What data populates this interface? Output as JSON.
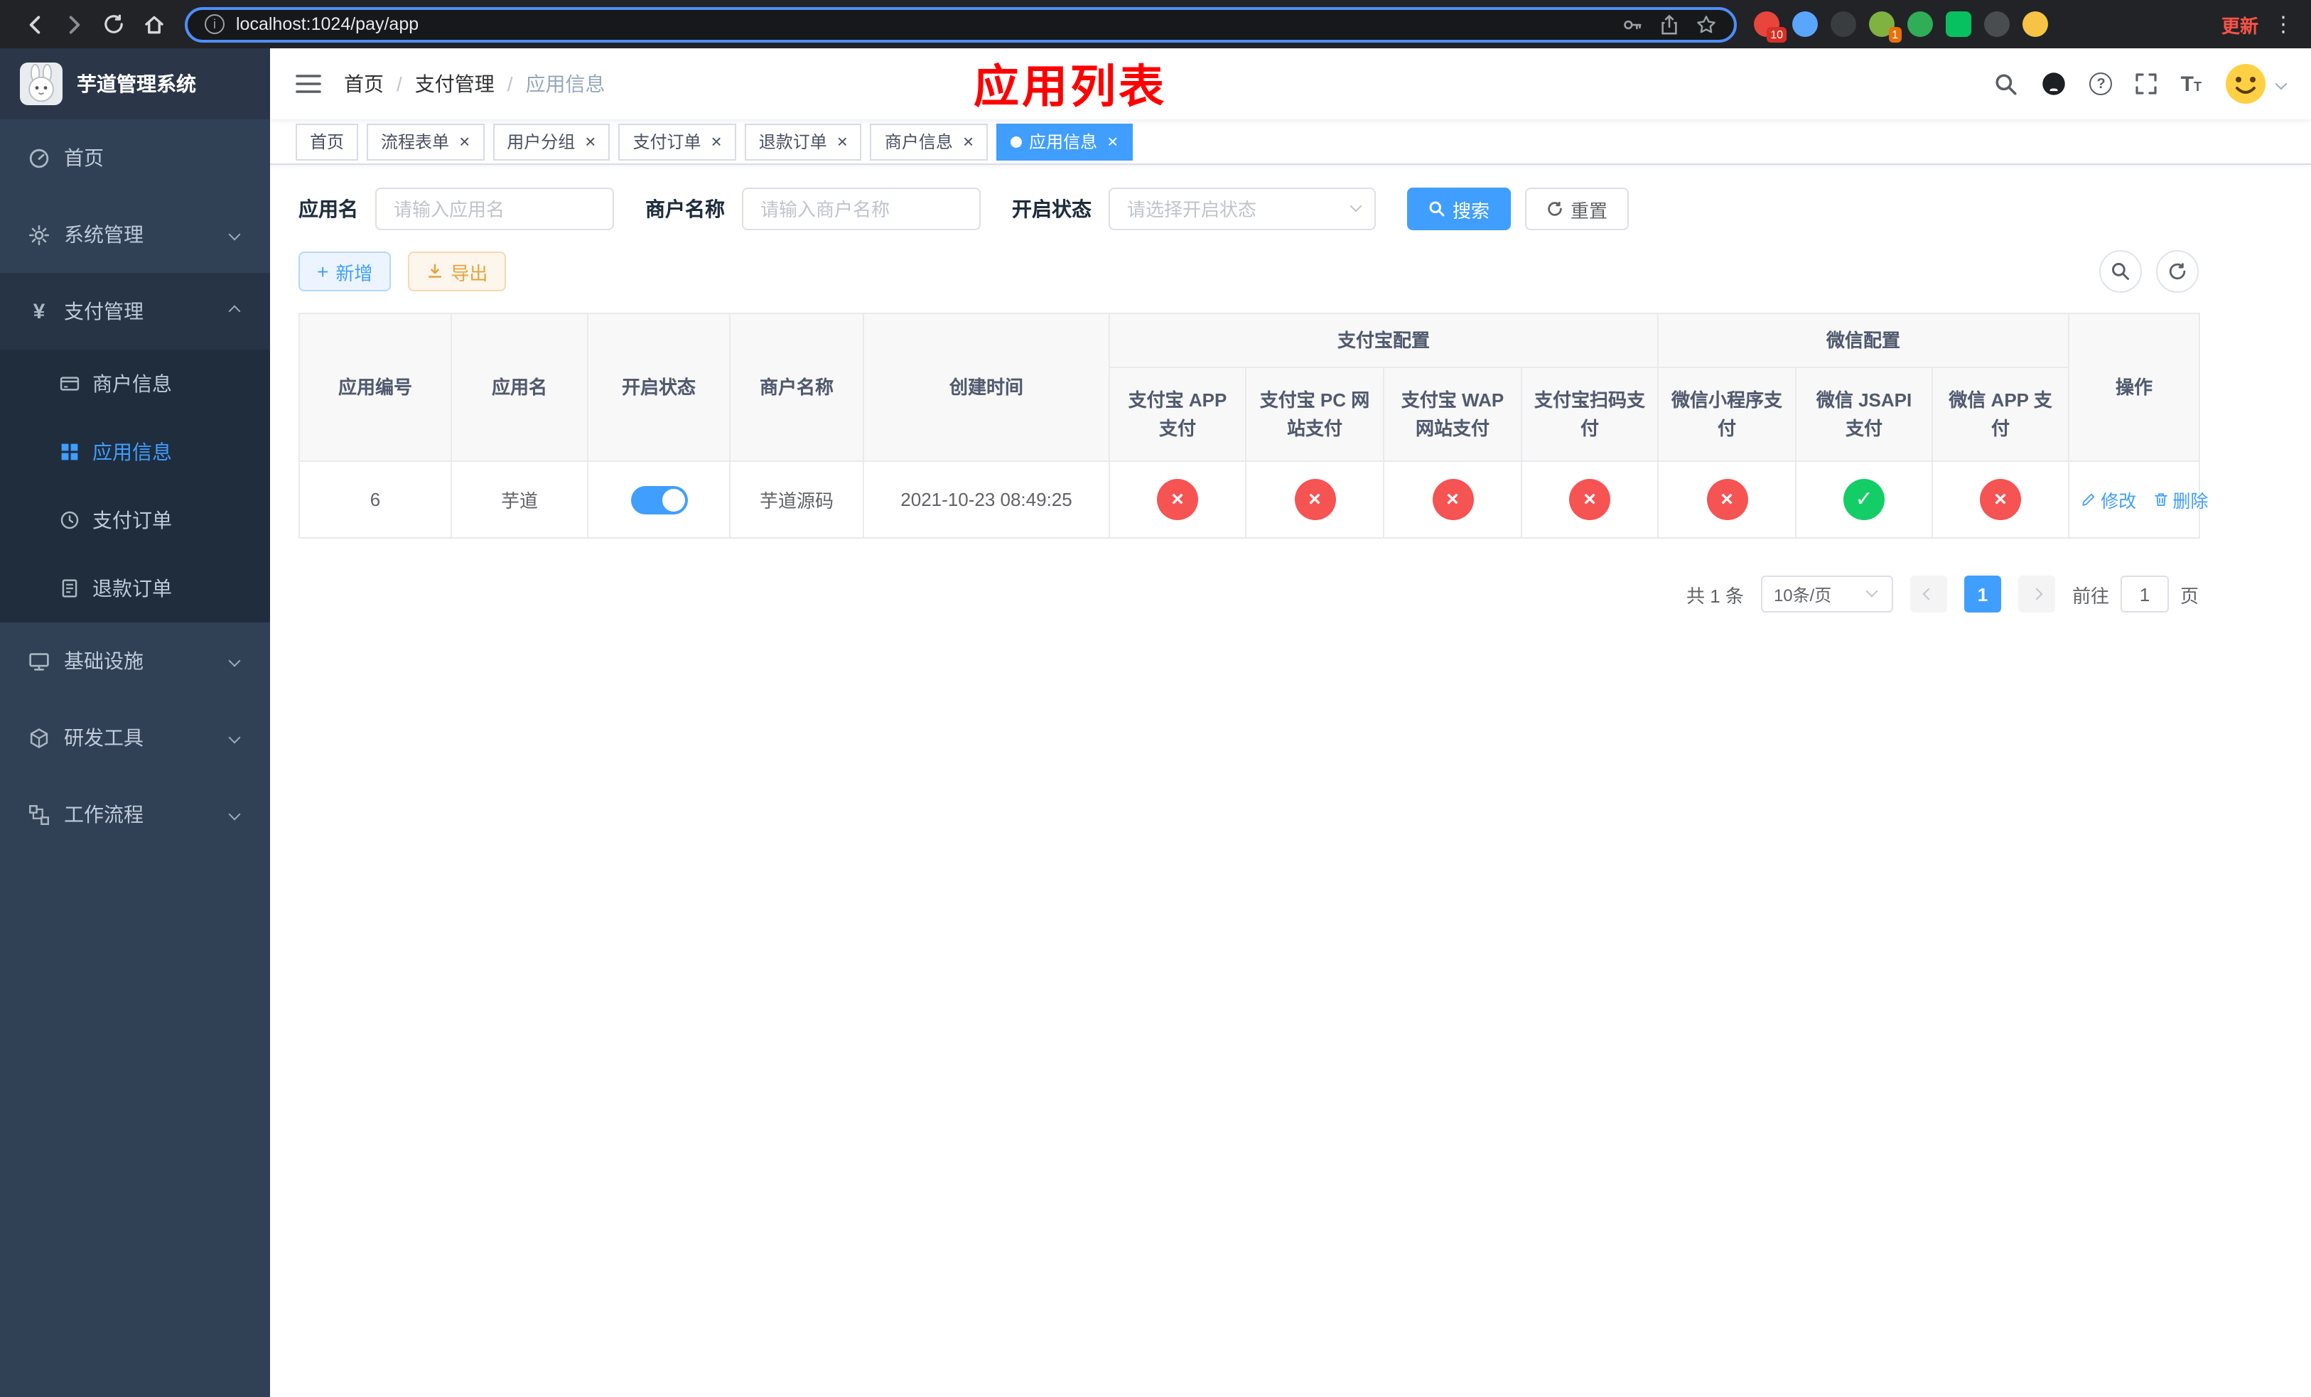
{
  "colors": {
    "accent": "#409eff",
    "danger": "#f65353",
    "success": "#13ce66",
    "warning": "#e6a23c",
    "title_red": "#ff0000",
    "sidebar_bg": "#304156",
    "sidebar_sub_bg": "#1f2d3d",
    "update_red": "#f55246"
  },
  "browser": {
    "url": "localhost:1024/pay/app",
    "update_label": "更新",
    "extensions": [
      {
        "color": "#e8453c",
        "badge": "10",
        "badge_color": "#d93025",
        "shape": "circle"
      },
      {
        "color": "#58a6ff",
        "badge": "",
        "shape": "circle"
      },
      {
        "color": "#3a3d40",
        "badge": "",
        "shape": "circle"
      },
      {
        "color": "#7fb241",
        "badge": "1",
        "badge_color": "#e8710a",
        "shape": "circle"
      },
      {
        "color": "#2fae57",
        "badge": "",
        "shape": "circle"
      },
      {
        "color": "#07c160",
        "badge": "",
        "shape": "square"
      },
      {
        "color": "#4a4d50",
        "badge": "",
        "shape": "circle"
      },
      {
        "color": "#f6c344",
        "badge": "",
        "shape": "circle"
      }
    ]
  },
  "sidebar": {
    "title": "芋道管理系统",
    "items": [
      {
        "label": "首页"
      },
      {
        "label": "系统管理"
      },
      {
        "label": "支付管理"
      },
      {
        "label": "基础设施"
      },
      {
        "label": "研发工具"
      },
      {
        "label": "工作流程"
      }
    ],
    "payment_children": [
      {
        "label": "商户信息"
      },
      {
        "label": "应用信息"
      },
      {
        "label": "支付订单"
      },
      {
        "label": "退款订单"
      }
    ]
  },
  "breadcrumb": {
    "items": [
      "首页",
      "支付管理",
      "应用信息"
    ],
    "separator": "/"
  },
  "header": {
    "title": "应用列表"
  },
  "tabs": [
    {
      "label": "首页",
      "closable": false
    },
    {
      "label": "流程表单",
      "closable": true
    },
    {
      "label": "用户分组",
      "closable": true
    },
    {
      "label": "支付订单",
      "closable": true
    },
    {
      "label": "退款订单",
      "closable": true
    },
    {
      "label": "商户信息",
      "closable": true
    },
    {
      "label": "应用信息",
      "closable": true
    }
  ],
  "filters": {
    "app_name": {
      "label": "应用名",
      "placeholder": "请输入应用名",
      "value": ""
    },
    "merchant_name": {
      "label": "商户名称",
      "placeholder": "请输入商户名称",
      "value": ""
    },
    "status": {
      "label": "开启状态",
      "placeholder": "请选择开启状态",
      "value": ""
    },
    "search_label": "搜索",
    "reset_label": "重置"
  },
  "toolbar": {
    "add_label": "新增",
    "export_label": "导出"
  },
  "table": {
    "headers": {
      "app_id": "应用编号",
      "app_name": "应用名",
      "status": "开启状态",
      "merchant": "商户名称",
      "create_time": "创建时间",
      "alipay_group": "支付宝配置",
      "wechat_group": "微信配置",
      "alipay_app": "支付宝 APP 支付",
      "alipay_pc": "支付宝 PC 网站支付",
      "alipay_wap": "支付宝 WAP 网站支付",
      "alipay_scan": "支付宝扫码支付",
      "wx_mini": "微信小程序支付",
      "wx_jsapi": "微信 JSAPI 支付",
      "wx_app": "微信 APP 支付",
      "action": "操作"
    },
    "rows": [
      {
        "id": "6",
        "name": "芋道",
        "enabled": true,
        "merchant": "芋道源码",
        "created_at": "2021-10-23 08:49:25",
        "configs": {
          "alipay_app": false,
          "alipay_pc": false,
          "alipay_wap": false,
          "alipay_scan": false,
          "wx_mini": false,
          "wx_jsapi": true,
          "wx_app": false
        },
        "edit_label": "修改",
        "delete_label": "删除"
      }
    ]
  },
  "pagination": {
    "total": "共 1 条",
    "page_size": "10条/页",
    "current_page": "1",
    "goto_label": "前往",
    "goto_value": "1",
    "unit_label": "页"
  }
}
